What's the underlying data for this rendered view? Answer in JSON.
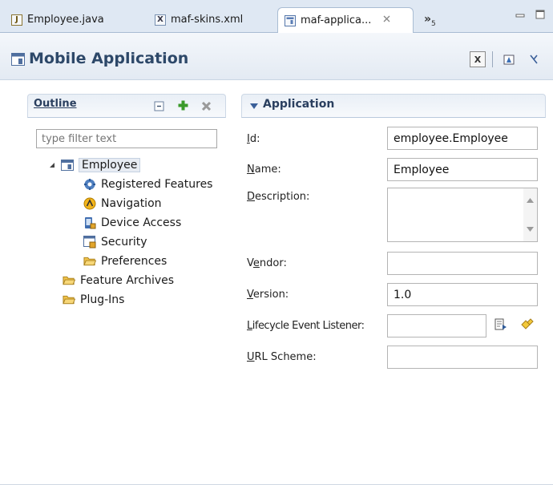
{
  "tabs": [
    {
      "label": "Employee.java",
      "icon": "java-file-icon"
    },
    {
      "label": "maf-skins.xml",
      "icon": "xml-file-icon"
    },
    {
      "label": "maf-applica...",
      "icon": "application-file-icon",
      "active": true
    }
  ],
  "overflow": {
    "label": "»",
    "count": "5"
  },
  "editor": {
    "title": "Mobile Application"
  },
  "outline": {
    "title": "Outline",
    "filter_placeholder": "type filter text",
    "tree": [
      {
        "label": "Employee",
        "icon": "application-icon",
        "level": 0,
        "expanded": true,
        "selected": true
      },
      {
        "label": "Registered Features",
        "icon": "features-icon",
        "level": 1
      },
      {
        "label": "Navigation",
        "icon": "navigation-icon",
        "level": 1
      },
      {
        "label": "Device Access",
        "icon": "device-access-icon",
        "level": 1
      },
      {
        "label": "Security",
        "icon": "security-icon",
        "level": 1
      },
      {
        "label": "Preferences",
        "icon": "folder-icon",
        "level": 1
      },
      {
        "label": "Feature Archives",
        "icon": "folder-icon",
        "level": 0
      },
      {
        "label": "Plug-Ins",
        "icon": "folder-icon",
        "level": 0
      }
    ]
  },
  "application": {
    "title": "Application",
    "fields": {
      "id": {
        "mn": "I",
        "rest": "d:",
        "value": "employee.Employee"
      },
      "name": {
        "mn": "N",
        "rest": "ame:",
        "value": "Employee"
      },
      "description": {
        "mn": "D",
        "rest": "escription:",
        "value": ""
      },
      "vendor": {
        "pre": "V",
        "mn": "e",
        "rest": "ndor:",
        "value": ""
      },
      "version": {
        "mn": "V",
        "rest": "ersion:",
        "value": "1.0"
      },
      "lifecycle": {
        "mn": "L",
        "rest": "ifecycle Event Listener:",
        "value": ""
      },
      "url_scheme": {
        "mn": "U",
        "rest": "RL Scheme:",
        "value": ""
      }
    }
  },
  "colors": {
    "header_text": "#2d4869",
    "tab_strip": "#dfe8f3",
    "section_border": "#b9c8dc",
    "add_green": "#3a9a2a"
  }
}
